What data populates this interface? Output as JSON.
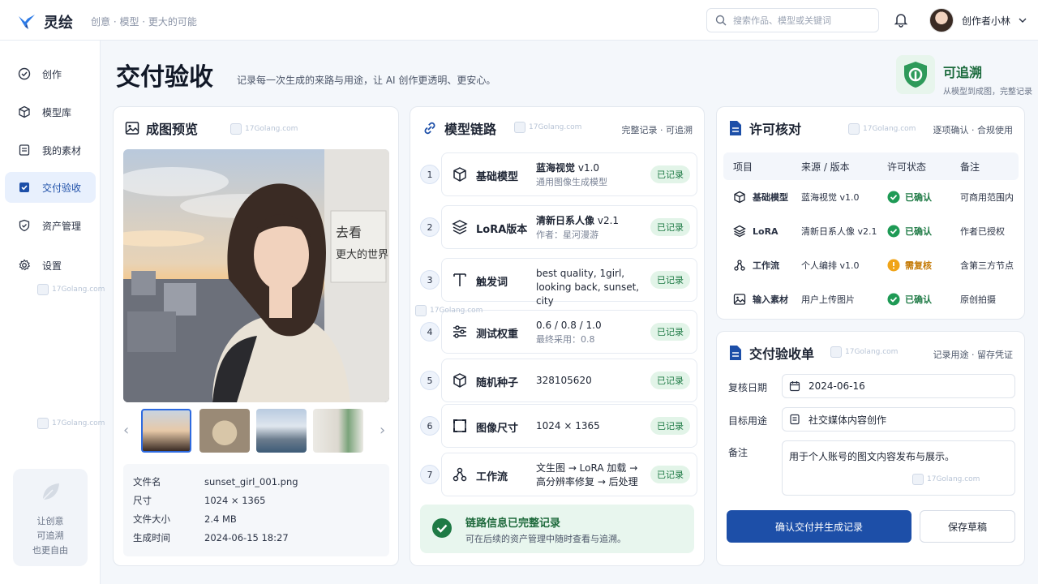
{
  "app": {
    "name": "灵绘",
    "slogan": "创意 · 模型 · 更大的可能"
  },
  "search": {
    "placeholder": "搜索作品、模型或关键词"
  },
  "user": {
    "name": "创作者小林"
  },
  "sidebar": {
    "items": [
      {
        "label": "创作",
        "icon": "check-circle-icon"
      },
      {
        "label": "模型库",
        "icon": "cube-icon"
      },
      {
        "label": "我的素材",
        "icon": "document-icon"
      },
      {
        "label": "交付验收",
        "icon": "checkbox-icon",
        "active": true
      },
      {
        "label": "资产管理",
        "icon": "shield-check-icon"
      },
      {
        "label": "设置",
        "icon": "gear-icon"
      }
    ],
    "card_lines": [
      "让创意",
      "可追溯",
      "也更自由"
    ]
  },
  "page": {
    "title": "交付验收",
    "subtitle": "记录每一次生成的来路与用途，让 AI 创作更透明、更安心。"
  },
  "trace": {
    "title": "可追溯",
    "subtitle": "从模型到成图，完整记录"
  },
  "watermark": "17Golang.com",
  "preview": {
    "title": "成图预览",
    "photo_text": [
      "去看",
      "更大的世界"
    ],
    "file_info": [
      {
        "label": "文件名",
        "value": "sunset_girl_001.png"
      },
      {
        "label": "尺寸",
        "value": "1024 × 1365"
      },
      {
        "label": "文件大小",
        "value": "2.4 MB"
      },
      {
        "label": "生成时间",
        "value": "2024-06-15  18:27"
      }
    ]
  },
  "chain": {
    "title": "模型链路",
    "right": "完整记录 · 可追溯",
    "badge": "已记录",
    "rows": [
      {
        "num": "1",
        "label": "基础模型",
        "value": "蓝海视觉",
        "value_suffix": "v1.0",
        "value2": "通用图像生成模型",
        "icon": "cube-icon"
      },
      {
        "num": "2",
        "label": "LoRA版本",
        "value": "清新日系人像",
        "value_suffix": "v2.1",
        "value2": "作者：星河漫游",
        "icon": "layers-icon"
      },
      {
        "num": "3",
        "label": "触发词",
        "value": "best quality, 1girl,",
        "value2": "looking back, sunset, city",
        "icon": "text-icon"
      },
      {
        "num": "4",
        "label": "测试权重",
        "value": "0.6 / 0.8 / 1.0",
        "value2": "最终采用：0.8",
        "icon": "sliders-icon"
      },
      {
        "num": "5",
        "label": "随机种子",
        "value": "328105620",
        "icon": "cube-icon"
      },
      {
        "num": "6",
        "label": "图像尺寸",
        "value": "1024 × 1365",
        "icon": "frame-icon"
      },
      {
        "num": "7",
        "label": "工作流",
        "value": "文生图 → LoRA 加载 →",
        "value2": "高分辨率修复 → 后处理",
        "icon": "workflow-icon"
      }
    ],
    "done_title": "链路信息已完整记录",
    "done_sub": "可在后续的资产管理中随时查看与追溯。"
  },
  "license": {
    "title": "许可核对",
    "right": "逐项确认 · 合规使用",
    "headers": [
      "项目",
      "来源 / 版本",
      "许可状态",
      "备注"
    ],
    "rows": [
      {
        "item": "基础模型",
        "source": "蓝海视觉 v1.0",
        "status": "已确认",
        "note": "可商用范围内",
        "ok": true
      },
      {
        "item": "LoRA",
        "source": "清新日系人像 v2.1",
        "status": "已确认",
        "note": "作者已授权",
        "ok": true
      },
      {
        "item": "工作流",
        "source": "个人编排 v1.0",
        "status": "需复核",
        "note": "含第三方节点",
        "ok": false
      },
      {
        "item": "输入素材",
        "source": "用户上传图片",
        "status": "已确认",
        "note": "原创拍摄",
        "ok": true
      }
    ]
  },
  "delivery": {
    "title": "交付验收单",
    "right": "记录用途 · 留存凭证",
    "date_label": "复核日期",
    "date_value": "2024-06-16",
    "usage_label": "目标用途",
    "usage_value": "社交媒体内容创作",
    "note_label": "备注",
    "note_value": "用于个人账号的图文内容发布与展示。",
    "confirm_button": "确认交付并生成记录",
    "save_button": "保存草稿"
  },
  "colors": {
    "accent": "#1d4fa8",
    "success": "#1e7a45",
    "warning": "#c47a06",
    "active_bg": "#e8f0fd"
  }
}
